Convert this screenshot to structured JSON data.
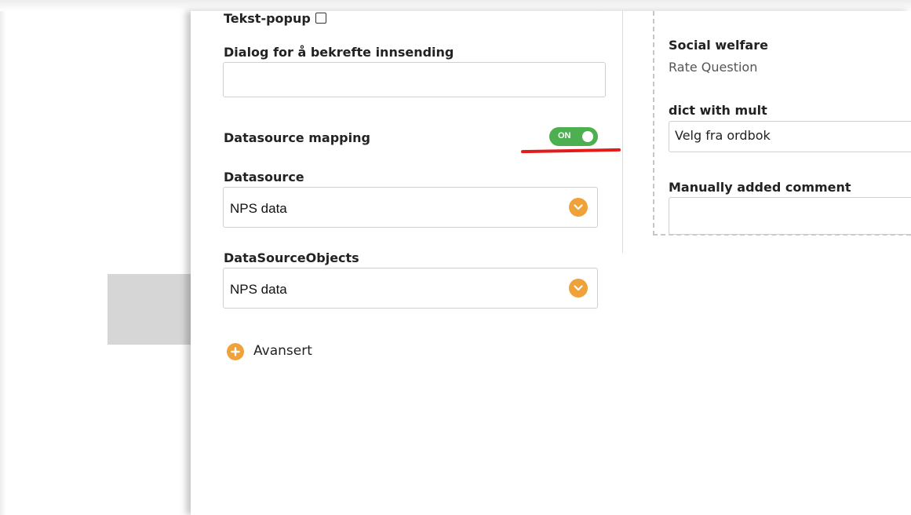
{
  "left_form": {
    "text_popup_label": "Tekst-popup",
    "text_popup_checked": false,
    "confirm_dialog_label": "Dialog for å bekrefte innsending",
    "confirm_dialog_value": "",
    "datasource_mapping_label": "Datasource mapping",
    "datasource_mapping_toggle": "ON",
    "datasource_label": "Datasource",
    "datasource_value": "NPS data",
    "datasource_objects_label": "DataSourceObjects",
    "datasource_objects_value": "NPS data",
    "advanced_label": "Avansert"
  },
  "right_preview": {
    "social_welfare_title": "Social welfare",
    "social_welfare_type": "Rate Question",
    "dict_label": "dict with mult",
    "dict_value": "Velg fra ordbok",
    "comment_label": "Manually added comment",
    "comment_value": ""
  },
  "colors": {
    "accent_orange": "#f0a23a",
    "toggle_green": "#4caf50",
    "annotation_red": "#e21c1c"
  },
  "icons": {
    "select_chevron": "chevron-down-icon",
    "advanced": "plus-circle-icon"
  }
}
